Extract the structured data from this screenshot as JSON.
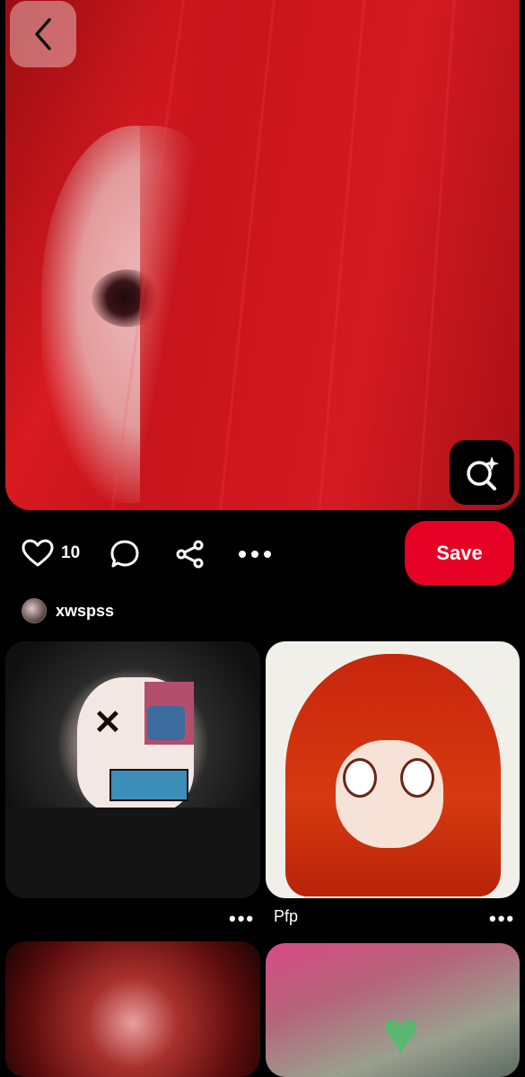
{
  "pin": {
    "like_count": "10",
    "save_label": "Save"
  },
  "author": {
    "name": "xwspss"
  },
  "feed": {
    "items": [
      {
        "label": ""
      },
      {
        "label": "Pfp"
      },
      {
        "label": ""
      },
      {
        "label": ""
      }
    ],
    "more_glyph": "•••"
  },
  "icons": {
    "back": "chevron-left-icon",
    "visual_search": "lens-sparkle-icon",
    "like": "heart-outline-icon",
    "comment": "comment-bubble-icon",
    "share": "share-icon",
    "more": "more-horizontal-icon"
  },
  "colors": {
    "save_button": "#e60023",
    "background": "#000000"
  }
}
